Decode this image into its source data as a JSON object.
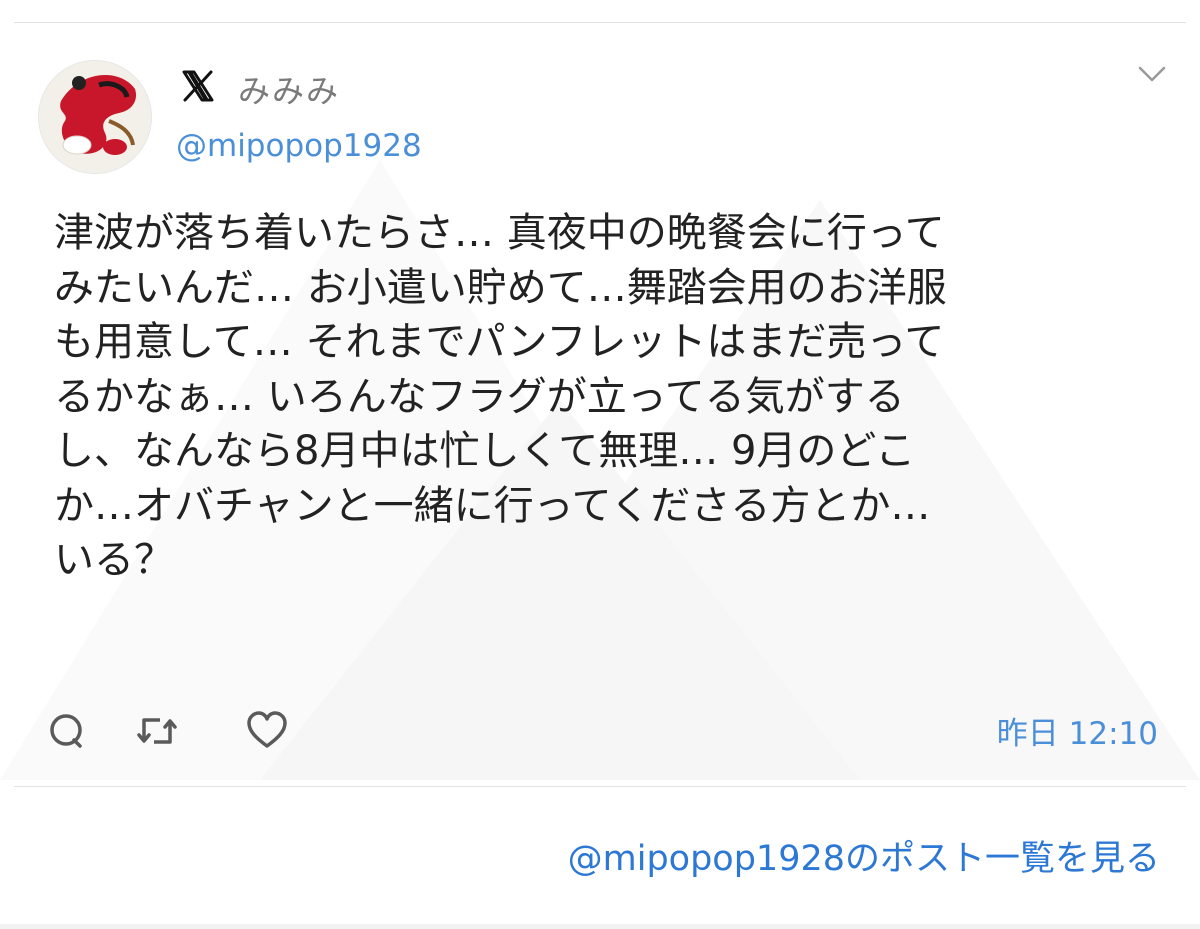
{
  "post": {
    "display_name": "みみみ",
    "handle": "@mipopop1928",
    "text_lines": [
      "津波が落ち着いたらさ… 真夜中の晩餐会に行って",
      "みたいんだ… お小遣い貯めて…舞踏会用のお洋服",
      "も用意して… それまでパンフレットはまだ売って",
      "るかなぁ… いろんなフラグが立ってる気がする",
      "し、なんなら8月中は忙しくて無理… 9月のどこ",
      "か…オバチャンと一緒に行ってくださる方とか…",
      "いる？"
    ],
    "timestamp": "昨日 12:10"
  },
  "footer": {
    "more_link": "@mipopop1928のポスト一覧を見る"
  },
  "colors": {
    "link": "#2c78d4",
    "handle": "#4a8fd8",
    "text": "#222222",
    "icon": "#5a5a5a"
  },
  "icons": {
    "brand": "x-logo-icon",
    "menu": "chevron-down-icon",
    "reply": "reply-icon",
    "retweet": "retweet-icon",
    "like": "heart-icon"
  }
}
